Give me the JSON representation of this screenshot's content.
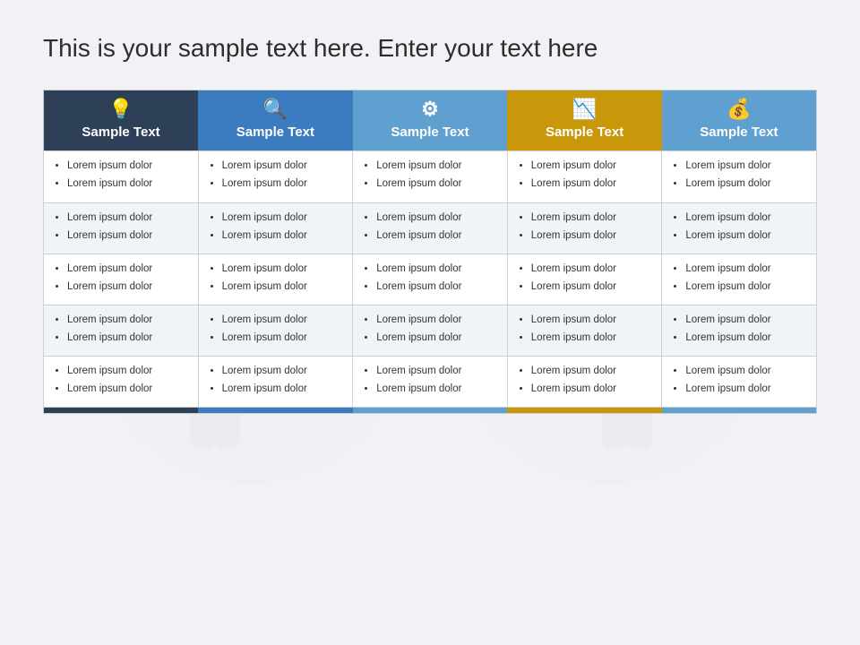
{
  "page": {
    "title": "This is your sample text here. Enter your text here"
  },
  "columns": [
    {
      "id": "col1",
      "label": "Sample Text",
      "icon": "💡",
      "icon_name": "lightbulb-icon",
      "color_class": "col1"
    },
    {
      "id": "col2",
      "label": "Sample Text",
      "icon": "🔍",
      "icon_name": "search-icon",
      "color_class": "col2"
    },
    {
      "id": "col3",
      "label": "Sample Text",
      "icon": "⚙",
      "icon_name": "gear-icon",
      "color_class": "col3"
    },
    {
      "id": "col4",
      "label": "Sample Text",
      "icon": "📉",
      "icon_name": "chart-icon",
      "color_class": "col4"
    },
    {
      "id": "col5",
      "label": "Sample Text",
      "icon": "💰",
      "icon_name": "money-icon",
      "color_class": "col5"
    }
  ],
  "rows": [
    {
      "row_class": "row-odd",
      "cells": [
        [
          "Lorem ipsum dolor",
          "Lorem ipsum dolor"
        ],
        [
          "Lorem ipsum dolor",
          "Lorem ipsum dolor"
        ],
        [
          "Lorem ipsum dolor",
          "Lorem ipsum dolor"
        ],
        [
          "Lorem ipsum dolor",
          "Lorem ipsum dolor"
        ],
        [
          "Lorem ipsum dolor",
          "Lorem ipsum dolor"
        ]
      ]
    },
    {
      "row_class": "row-even",
      "cells": [
        [
          "Lorem ipsum dolor",
          "Lorem ipsum dolor"
        ],
        [
          "Lorem ipsum dolor",
          "Lorem ipsum dolor"
        ],
        [
          "Lorem ipsum dolor",
          "Lorem ipsum dolor"
        ],
        [
          "Lorem ipsum dolor",
          "Lorem ipsum dolor"
        ],
        [
          "Lorem ipsum dolor",
          "Lorem ipsum dolor"
        ]
      ]
    },
    {
      "row_class": "row-odd",
      "cells": [
        [
          "Lorem ipsum dolor",
          "Lorem ipsum dolor"
        ],
        [
          "Lorem ipsum dolor",
          "Lorem ipsum dolor"
        ],
        [
          "Lorem ipsum dolor",
          "Lorem ipsum dolor"
        ],
        [
          "Lorem ipsum dolor",
          "Lorem ipsum dolor"
        ],
        [
          "Lorem ipsum dolor",
          "Lorem ipsum dolor"
        ]
      ]
    },
    {
      "row_class": "row-even",
      "cells": [
        [
          "Lorem ipsum dolor",
          "Lorem ipsum dolor"
        ],
        [
          "Lorem ipsum dolor",
          "Lorem ipsum dolor"
        ],
        [
          "Lorem ipsum dolor",
          "Lorem ipsum dolor"
        ],
        [
          "Lorem ipsum dolor",
          "Lorem ipsum dolor"
        ],
        [
          "Lorem ipsum dolor",
          "Lorem ipsum dolor"
        ]
      ]
    },
    {
      "row_class": "row-odd",
      "cells": [
        [
          "Lorem ipsum dolor",
          "Lorem ipsum dolor"
        ],
        [
          "Lorem ipsum dolor",
          "Lorem ipsum dolor"
        ],
        [
          "Lorem ipsum dolor",
          "Lorem ipsum dolor"
        ],
        [
          "Lorem ipsum dolor",
          "Lorem ipsum dolor"
        ],
        [
          "Lorem ipsum dolor",
          "Lorem ipsum dolor"
        ]
      ]
    }
  ],
  "icons": {
    "lightbulb": "💡",
    "search": "🔍",
    "gear": "⚙",
    "chart": "📉",
    "money": "💰"
  }
}
